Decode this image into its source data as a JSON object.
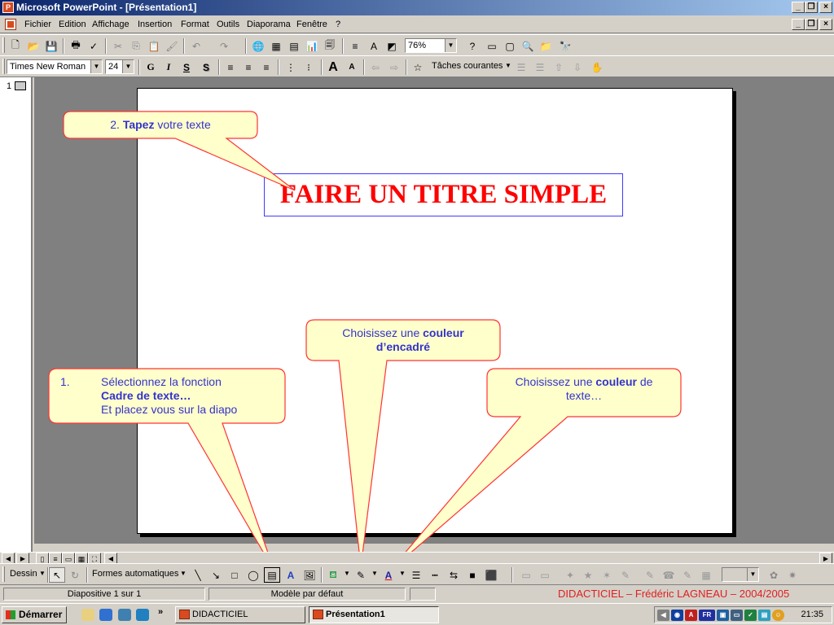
{
  "window": {
    "title": "Microsoft PowerPoint - [Présentation1]"
  },
  "menu": {
    "items": [
      "Fichier",
      "Edition",
      "Affichage",
      "Insertion",
      "Format",
      "Outils",
      "Diaporama",
      "Fenêtre",
      "?"
    ]
  },
  "toolbar_standard": {
    "zoom": "76%"
  },
  "toolbar_format": {
    "font": "Times New Roman",
    "size": "24",
    "bold": "G",
    "italic": "I",
    "underline": "S",
    "shadow": "S",
    "tasks": "Tâches courantes"
  },
  "outline": {
    "slide_number": "1"
  },
  "slide": {
    "title": "FAIRE UN TITRE SIMPLE"
  },
  "callouts": {
    "tapez_prefix": "2. ",
    "tapez_bold": "Tapez",
    "tapez_rest": " votre texte",
    "encadre_line1": "Choisissez une ",
    "encadre_bold1": "couleur",
    "encadre_bold2": "d’encadré",
    "texte_line1": "Choisissez une ",
    "texte_bold": "couleur",
    "texte_rest": " de",
    "texte_line2": "texte…",
    "step_number": "1.",
    "step_line1": "Sélectionnez la fonction",
    "step_bold": "Cadre de texte…",
    "step_line3": "Et placez vous sur la diapo"
  },
  "drawing_toolbar": {
    "draw": "Dessin",
    "autoshapes": "Formes automatiques"
  },
  "status": {
    "slide": "Diapositive 1 sur 1",
    "template": "Modèle par défaut",
    "credit": "DIDACTICIEL – Frédéric LAGNEAU – 2004/2005"
  },
  "taskbar": {
    "start": "Démarrer",
    "tasks": [
      "DIDACTICIEL",
      "Présentation1"
    ],
    "tray_lang": "FR",
    "clock": "21:35"
  },
  "colors": {
    "title_red": "#ff0000",
    "callout_fill": "#ffffcc",
    "callout_text": "#3333cc",
    "credit_red": "#e02020"
  }
}
